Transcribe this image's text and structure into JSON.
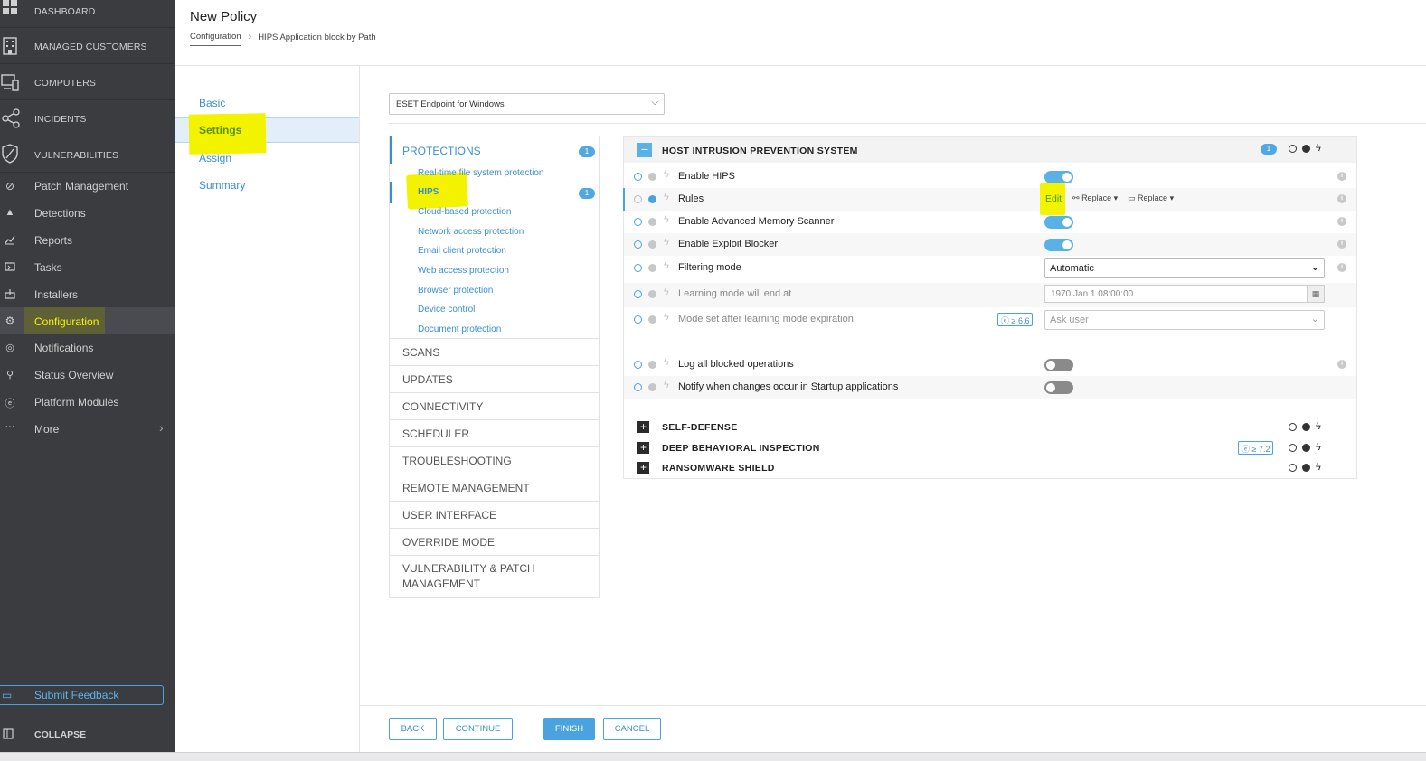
{
  "sidebar": {
    "top_items": [
      {
        "label": "DASHBOARD",
        "icon": "dashboard-icon"
      },
      {
        "label": "MANAGED CUSTOMERS",
        "icon": "building-icon"
      },
      {
        "label": "COMPUTERS",
        "icon": "computer-icon"
      },
      {
        "label": "INCIDENTS",
        "icon": "incidents-icon"
      },
      {
        "label": "VULNERABILITIES",
        "icon": "shield-icon"
      }
    ],
    "items": [
      {
        "label": "Patch Management",
        "icon": "patch-icon"
      },
      {
        "label": "Detections",
        "icon": "warning-icon"
      },
      {
        "label": "Reports",
        "icon": "reports-icon"
      },
      {
        "label": "Tasks",
        "icon": "tasks-icon"
      },
      {
        "label": "Installers",
        "icon": "installer-icon"
      },
      {
        "label": "Configuration",
        "icon": "gear-icon",
        "active": true
      },
      {
        "label": "Notifications",
        "icon": "bell-icon"
      },
      {
        "label": "Status Overview",
        "icon": "status-icon"
      },
      {
        "label": "Platform Modules",
        "icon": "modules-icon"
      },
      {
        "label": "More",
        "icon": "more-icon"
      }
    ],
    "feedback_label": "Submit Feedback",
    "collapse_label": "COLLAPSE"
  },
  "header": {
    "title": "New Policy",
    "breadcrumb": [
      "Configuration",
      "HIPS Application block by Path"
    ]
  },
  "steps": [
    "Basic",
    "Settings",
    "Assign",
    "Summary"
  ],
  "product_select": {
    "value": "ESET Endpoint for Windows"
  },
  "tree": {
    "section": "PROTECTIONS",
    "section_badge": "1",
    "subitems": [
      {
        "label": "Real-time file system protection"
      },
      {
        "label": "HIPS",
        "badge": "1"
      },
      {
        "label": "Cloud-based protection"
      },
      {
        "label": "Network access protection"
      },
      {
        "label": "Email client protection"
      },
      {
        "label": "Web access protection"
      },
      {
        "label": "Browser protection"
      },
      {
        "label": "Device control"
      },
      {
        "label": "Document protection"
      }
    ],
    "categories": [
      "SCANS",
      "UPDATES",
      "CONNECTIVITY",
      "SCHEDULER",
      "TROUBLESHOOTING",
      "REMOTE MANAGEMENT",
      "USER INTERFACE",
      "OVERRIDE MODE",
      "VULNERABILITY & PATCH MANAGEMENT"
    ]
  },
  "panel": {
    "hips_title": "HOST INTRUSION PREVENTION SYSTEM",
    "hips_badge": "1",
    "rows": {
      "enable_hips": {
        "label": "Enable HIPS",
        "on": true
      },
      "rules": {
        "label": "Rules",
        "edit": "Edit",
        "replace1": "Replace",
        "replace2": "Replace"
      },
      "ams": {
        "label": "Enable Advanced Memory Scanner",
        "on": true
      },
      "exploit": {
        "label": "Enable Exploit Blocker",
        "on": true
      },
      "filtering": {
        "label": "Filtering mode",
        "value": "Automatic"
      },
      "learning": {
        "label": "Learning mode will end at",
        "value": "1970 Jan 1 08:00:00"
      },
      "mode_after": {
        "label": "Mode set after learning mode expiration",
        "version": "≥ 6.6",
        "value": "Ask user"
      },
      "log_blocked": {
        "label": "Log all blocked operations",
        "on": false
      },
      "notify_startup": {
        "label": "Notify when changes occur in Startup applications",
        "on": false
      }
    },
    "sections": [
      {
        "title": "SELF-DEFENSE"
      },
      {
        "title": "DEEP BEHAVIORAL INSPECTION",
        "version": "≥ 7.2"
      },
      {
        "title": "RANSOMWARE SHIELD"
      }
    ]
  },
  "footer": {
    "back": "BACK",
    "continue": "CONTINUE",
    "finish": "FINISH",
    "cancel": "CANCEL"
  },
  "colors": {
    "accent": "#4aa3df",
    "sidebar": "#3b3c40",
    "highlight": "#f3f300"
  }
}
